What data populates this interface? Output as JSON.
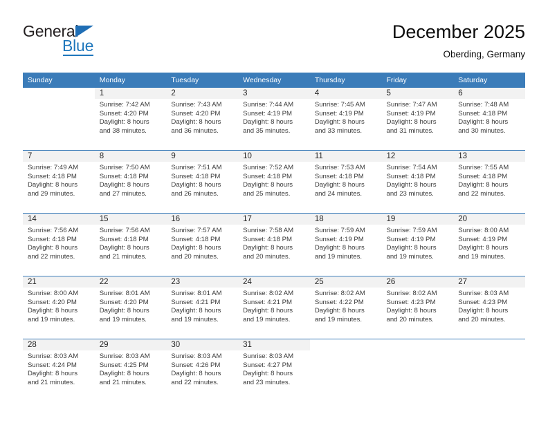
{
  "brand": {
    "name_part1": "General",
    "name_part2": "Blue",
    "triangle_color": "#1f6eb5",
    "blue_color": "#1f77bc"
  },
  "header": {
    "month_title": "December 2025",
    "location": "Oberding, Germany"
  },
  "calendar": {
    "header_bg": "#3b7cb9",
    "shaded_bg": "#f2f2f2",
    "weekday_headers": [
      "Sunday",
      "Monday",
      "Tuesday",
      "Wednesday",
      "Thursday",
      "Friday",
      "Saturday"
    ],
    "weeks": [
      {
        "shaded": true,
        "days": [
          {
            "day": "",
            "sunrise": "",
            "sunset": "",
            "daylight_line1": "",
            "daylight_line2": ""
          },
          {
            "day": "1",
            "sunrise": "Sunrise: 7:42 AM",
            "sunset": "Sunset: 4:20 PM",
            "daylight_line1": "Daylight: 8 hours",
            "daylight_line2": "and 38 minutes."
          },
          {
            "day": "2",
            "sunrise": "Sunrise: 7:43 AM",
            "sunset": "Sunset: 4:20 PM",
            "daylight_line1": "Daylight: 8 hours",
            "daylight_line2": "and 36 minutes."
          },
          {
            "day": "3",
            "sunrise": "Sunrise: 7:44 AM",
            "sunset": "Sunset: 4:19 PM",
            "daylight_line1": "Daylight: 8 hours",
            "daylight_line2": "and 35 minutes."
          },
          {
            "day": "4",
            "sunrise": "Sunrise: 7:45 AM",
            "sunset": "Sunset: 4:19 PM",
            "daylight_line1": "Daylight: 8 hours",
            "daylight_line2": "and 33 minutes."
          },
          {
            "day": "5",
            "sunrise": "Sunrise: 7:47 AM",
            "sunset": "Sunset: 4:19 PM",
            "daylight_line1": "Daylight: 8 hours",
            "daylight_line2": "and 31 minutes."
          },
          {
            "day": "6",
            "sunrise": "Sunrise: 7:48 AM",
            "sunset": "Sunset: 4:18 PM",
            "daylight_line1": "Daylight: 8 hours",
            "daylight_line2": "and 30 minutes."
          }
        ]
      },
      {
        "shaded": true,
        "days": [
          {
            "day": "7",
            "sunrise": "Sunrise: 7:49 AM",
            "sunset": "Sunset: 4:18 PM",
            "daylight_line1": "Daylight: 8 hours",
            "daylight_line2": "and 29 minutes."
          },
          {
            "day": "8",
            "sunrise": "Sunrise: 7:50 AM",
            "sunset": "Sunset: 4:18 PM",
            "daylight_line1": "Daylight: 8 hours",
            "daylight_line2": "and 27 minutes."
          },
          {
            "day": "9",
            "sunrise": "Sunrise: 7:51 AM",
            "sunset": "Sunset: 4:18 PM",
            "daylight_line1": "Daylight: 8 hours",
            "daylight_line2": "and 26 minutes."
          },
          {
            "day": "10",
            "sunrise": "Sunrise: 7:52 AM",
            "sunset": "Sunset: 4:18 PM",
            "daylight_line1": "Daylight: 8 hours",
            "daylight_line2": "and 25 minutes."
          },
          {
            "day": "11",
            "sunrise": "Sunrise: 7:53 AM",
            "sunset": "Sunset: 4:18 PM",
            "daylight_line1": "Daylight: 8 hours",
            "daylight_line2": "and 24 minutes."
          },
          {
            "day": "12",
            "sunrise": "Sunrise: 7:54 AM",
            "sunset": "Sunset: 4:18 PM",
            "daylight_line1": "Daylight: 8 hours",
            "daylight_line2": "and 23 minutes."
          },
          {
            "day": "13",
            "sunrise": "Sunrise: 7:55 AM",
            "sunset": "Sunset: 4:18 PM",
            "daylight_line1": "Daylight: 8 hours",
            "daylight_line2": "and 22 minutes."
          }
        ]
      },
      {
        "shaded": true,
        "days": [
          {
            "day": "14",
            "sunrise": "Sunrise: 7:56 AM",
            "sunset": "Sunset: 4:18 PM",
            "daylight_line1": "Daylight: 8 hours",
            "daylight_line2": "and 22 minutes."
          },
          {
            "day": "15",
            "sunrise": "Sunrise: 7:56 AM",
            "sunset": "Sunset: 4:18 PM",
            "daylight_line1": "Daylight: 8 hours",
            "daylight_line2": "and 21 minutes."
          },
          {
            "day": "16",
            "sunrise": "Sunrise: 7:57 AM",
            "sunset": "Sunset: 4:18 PM",
            "daylight_line1": "Daylight: 8 hours",
            "daylight_line2": "and 20 minutes."
          },
          {
            "day": "17",
            "sunrise": "Sunrise: 7:58 AM",
            "sunset": "Sunset: 4:18 PM",
            "daylight_line1": "Daylight: 8 hours",
            "daylight_line2": "and 20 minutes."
          },
          {
            "day": "18",
            "sunrise": "Sunrise: 7:59 AM",
            "sunset": "Sunset: 4:19 PM",
            "daylight_line1": "Daylight: 8 hours",
            "daylight_line2": "and 19 minutes."
          },
          {
            "day": "19",
            "sunrise": "Sunrise: 7:59 AM",
            "sunset": "Sunset: 4:19 PM",
            "daylight_line1": "Daylight: 8 hours",
            "daylight_line2": "and 19 minutes."
          },
          {
            "day": "20",
            "sunrise": "Sunrise: 8:00 AM",
            "sunset": "Sunset: 4:19 PM",
            "daylight_line1": "Daylight: 8 hours",
            "daylight_line2": "and 19 minutes."
          }
        ]
      },
      {
        "shaded": true,
        "days": [
          {
            "day": "21",
            "sunrise": "Sunrise: 8:00 AM",
            "sunset": "Sunset: 4:20 PM",
            "daylight_line1": "Daylight: 8 hours",
            "daylight_line2": "and 19 minutes."
          },
          {
            "day": "22",
            "sunrise": "Sunrise: 8:01 AM",
            "sunset": "Sunset: 4:20 PM",
            "daylight_line1": "Daylight: 8 hours",
            "daylight_line2": "and 19 minutes."
          },
          {
            "day": "23",
            "sunrise": "Sunrise: 8:01 AM",
            "sunset": "Sunset: 4:21 PM",
            "daylight_line1": "Daylight: 8 hours",
            "daylight_line2": "and 19 minutes."
          },
          {
            "day": "24",
            "sunrise": "Sunrise: 8:02 AM",
            "sunset": "Sunset: 4:21 PM",
            "daylight_line1": "Daylight: 8 hours",
            "daylight_line2": "and 19 minutes."
          },
          {
            "day": "25",
            "sunrise": "Sunrise: 8:02 AM",
            "sunset": "Sunset: 4:22 PM",
            "daylight_line1": "Daylight: 8 hours",
            "daylight_line2": "and 19 minutes."
          },
          {
            "day": "26",
            "sunrise": "Sunrise: 8:02 AM",
            "sunset": "Sunset: 4:23 PM",
            "daylight_line1": "Daylight: 8 hours",
            "daylight_line2": "and 20 minutes."
          },
          {
            "day": "27",
            "sunrise": "Sunrise: 8:03 AM",
            "sunset": "Sunset: 4:23 PM",
            "daylight_line1": "Daylight: 8 hours",
            "daylight_line2": "and 20 minutes."
          }
        ]
      },
      {
        "shaded": true,
        "days": [
          {
            "day": "28",
            "sunrise": "Sunrise: 8:03 AM",
            "sunset": "Sunset: 4:24 PM",
            "daylight_line1": "Daylight: 8 hours",
            "daylight_line2": "and 21 minutes."
          },
          {
            "day": "29",
            "sunrise": "Sunrise: 8:03 AM",
            "sunset": "Sunset: 4:25 PM",
            "daylight_line1": "Daylight: 8 hours",
            "daylight_line2": "and 21 minutes."
          },
          {
            "day": "30",
            "sunrise": "Sunrise: 8:03 AM",
            "sunset": "Sunset: 4:26 PM",
            "daylight_line1": "Daylight: 8 hours",
            "daylight_line2": "and 22 minutes."
          },
          {
            "day": "31",
            "sunrise": "Sunrise: 8:03 AM",
            "sunset": "Sunset: 4:27 PM",
            "daylight_line1": "Daylight: 8 hours",
            "daylight_line2": "and 23 minutes."
          },
          {
            "day": "",
            "sunrise": "",
            "sunset": "",
            "daylight_line1": "",
            "daylight_line2": ""
          },
          {
            "day": "",
            "sunrise": "",
            "sunset": "",
            "daylight_line1": "",
            "daylight_line2": ""
          },
          {
            "day": "",
            "sunrise": "",
            "sunset": "",
            "daylight_line1": "",
            "daylight_line2": ""
          }
        ]
      }
    ]
  }
}
